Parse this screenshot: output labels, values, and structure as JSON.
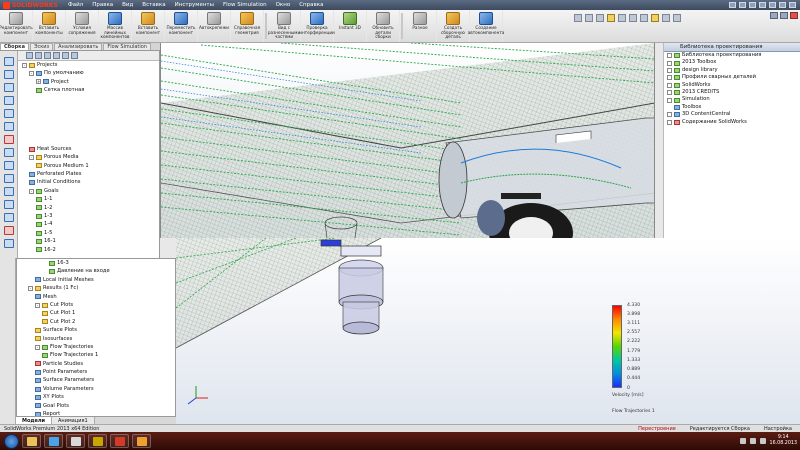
{
  "app": {
    "logo_text": "SOLIDWORKS",
    "menu": [
      "Файл",
      "Правка",
      "Вид",
      "Вставка",
      "Инструменты",
      "Flow Simulation",
      "Окно",
      "Справка"
    ]
  },
  "commands": [
    {
      "label": "Редактировать компонент",
      "icon": "edit-component-icon",
      "tone": "gr"
    },
    {
      "label": "Вставить компоненты",
      "icon": "insert-components-icon",
      "tone": "y"
    },
    {
      "label": "Условия сопряжения",
      "icon": "mate-icon",
      "tone": "gr"
    },
    {
      "label": "Массив линейных компонентов",
      "icon": "linear-pattern-icon",
      "tone": "b"
    },
    {
      "label": "Вставить компонент",
      "icon": "insert-component-icon",
      "tone": "y"
    },
    {
      "label": "Переместить компонент",
      "icon": "move-component-icon",
      "tone": "b"
    },
    {
      "label": "Автокрепежи",
      "icon": "smart-fasteners-icon",
      "tone": "gr"
    },
    {
      "label": "Справочная геометрия",
      "icon": "reference-geometry-icon",
      "tone": "y"
    },
    {
      "label": "Вид с разнесенными частями",
      "icon": "exploded-view-icon",
      "tone": "gr"
    },
    {
      "label": "Проверка интерференции",
      "icon": "interference-icon",
      "tone": "b"
    },
    {
      "label": "Instant 3D",
      "icon": "instant3d-icon",
      "tone": "g"
    },
    {
      "label": "Обновить детали сборки",
      "icon": "update-icon",
      "tone": "gr"
    },
    {
      "label": "Разное",
      "icon": "misc-icon",
      "tone": "gr"
    },
    {
      "label": "Создать сборочную деталь",
      "icon": "assembly-part-icon",
      "tone": "y"
    },
    {
      "label": "Создание автокомпонента",
      "icon": "auto-component-icon",
      "tone": "b"
    }
  ],
  "tabs": [
    "Сборка",
    "Эскиз",
    "Анализировать",
    "Flow Simulation"
  ],
  "tree_top": [
    {
      "label": "Projects",
      "indent": 0,
      "icon": "y",
      "pm": "-"
    },
    {
      "label": "По умолчанию",
      "indent": 1,
      "icon": "b",
      "pm": "-"
    },
    {
      "label": "Project",
      "indent": 2,
      "icon": "b",
      "pm": "+"
    },
    {
      "label": "Сетка плотная",
      "indent": 2,
      "icon": "g",
      "pm": ""
    },
    {
      "label": "",
      "indent": 0,
      "icon": "",
      "pm": ""
    },
    {
      "label": "",
      "indent": 0,
      "icon": "",
      "pm": ""
    },
    {
      "label": "",
      "indent": 0,
      "icon": "",
      "pm": ""
    },
    {
      "label": "",
      "indent": 0,
      "icon": "",
      "pm": ""
    },
    {
      "label": "",
      "indent": 0,
      "icon": "",
      "pm": ""
    },
    {
      "label": "",
      "indent": 0,
      "icon": "",
      "pm": ""
    },
    {
      "label": "Heat Sources",
      "indent": 1,
      "icon": "r",
      "pm": ""
    },
    {
      "label": "Porous Media",
      "indent": 1,
      "icon": "y",
      "pm": "-"
    },
    {
      "label": "Porous Medium 1",
      "indent": 2,
      "icon": "y",
      "pm": ""
    },
    {
      "label": "Perforated Plates",
      "indent": 1,
      "icon": "b",
      "pm": ""
    },
    {
      "label": "Initial Conditions",
      "indent": 1,
      "icon": "b",
      "pm": ""
    },
    {
      "label": "Goals",
      "indent": 1,
      "icon": "g",
      "pm": "-"
    },
    {
      "label": "1-1",
      "indent": 2,
      "icon": "g",
      "pm": ""
    },
    {
      "label": "1-2",
      "indent": 2,
      "icon": "g",
      "pm": ""
    },
    {
      "label": "1-3",
      "indent": 2,
      "icon": "g",
      "pm": ""
    },
    {
      "label": "1-4",
      "indent": 2,
      "icon": "g",
      "pm": ""
    },
    {
      "label": "1-5",
      "indent": 2,
      "icon": "g",
      "pm": ""
    },
    {
      "label": "16-1",
      "indent": 2,
      "icon": "g",
      "pm": ""
    },
    {
      "label": "16-2",
      "indent": 2,
      "icon": "g",
      "pm": ""
    }
  ],
  "tree_bottom": [
    {
      "label": "16-3",
      "indent": 4,
      "icon": "g",
      "pm": ""
    },
    {
      "label": "Давление на входе",
      "indent": 4,
      "icon": "g",
      "pm": ""
    },
    {
      "label": "Local Initial Meshes",
      "indent": 2,
      "icon": "b",
      "pm": ""
    },
    {
      "label": "Results (1 Fc)",
      "indent": 1,
      "icon": "y",
      "pm": "-"
    },
    {
      "label": "Mesh",
      "indent": 2,
      "icon": "b",
      "pm": ""
    },
    {
      "label": "Cut Plots",
      "indent": 2,
      "icon": "y",
      "pm": "-"
    },
    {
      "label": "Cut Plot 1",
      "indent": 3,
      "icon": "y",
      "pm": ""
    },
    {
      "label": "Cut Plot 2",
      "indent": 3,
      "icon": "y",
      "pm": ""
    },
    {
      "label": "Surface Plots",
      "indent": 2,
      "icon": "y",
      "pm": ""
    },
    {
      "label": "Isosurfaces",
      "indent": 2,
      "icon": "y",
      "pm": ""
    },
    {
      "label": "Flow Trajectories",
      "indent": 2,
      "icon": "g",
      "pm": "-"
    },
    {
      "label": "Flow Trajectories 1",
      "indent": 3,
      "icon": "g",
      "pm": ""
    },
    {
      "label": "Particle Studies",
      "indent": 2,
      "icon": "r",
      "pm": ""
    },
    {
      "label": "Point Parameters",
      "indent": 2,
      "icon": "b",
      "pm": ""
    },
    {
      "label": "Surface Parameters",
      "indent": 2,
      "icon": "b",
      "pm": ""
    },
    {
      "label": "Volume Parameters",
      "indent": 2,
      "icon": "b",
      "pm": ""
    },
    {
      "label": "XY Plots",
      "indent": 2,
      "icon": "b",
      "pm": ""
    },
    {
      "label": "Goal Plots",
      "indent": 2,
      "icon": "b",
      "pm": ""
    },
    {
      "label": "Report",
      "indent": 2,
      "icon": "b",
      "pm": ""
    },
    {
      "label": "Animations",
      "indent": 2,
      "icon": "b",
      "pm": ""
    },
    {
      "label": "Reference Parameters",
      "indent": 2,
      "icon": "b",
      "pm": ""
    }
  ],
  "tree_bottom_tabs": [
    "Модели",
    "Анимация1"
  ],
  "taskpane": {
    "title": "Библиотека проектирования",
    "items": [
      {
        "label": "Библиотека проектирования",
        "icon": "g",
        "pm": "+"
      },
      {
        "label": "2013 Toolbox",
        "icon": "g",
        "pm": "+"
      },
      {
        "label": "design library",
        "icon": "g",
        "pm": "+"
      },
      {
        "label": "Профили сварных деталей",
        "icon": "g",
        "pm": "+"
      },
      {
        "label": "SolidWorks",
        "icon": "g",
        "pm": "+"
      },
      {
        "label": "2013 CREDITS",
        "icon": "g",
        "pm": "+"
      },
      {
        "label": "Simulation",
        "icon": "g",
        "pm": "+"
      },
      {
        "label": "Toolbox",
        "icon": "b",
        "pm": ""
      },
      {
        "label": "3D ContentCentral",
        "icon": "b",
        "pm": "+"
      },
      {
        "label": "Содержание SolidWorks",
        "icon": "r",
        "pm": "+"
      }
    ]
  },
  "legend": {
    "values": [
      "4.330",
      "3.898",
      "3.111",
      "2.557",
      "2.222",
      "1.779",
      "1.333",
      "0.889",
      "0.444",
      "0"
    ],
    "title": "Velocity [m/s]",
    "footer": "Flow Trajectories 1"
  },
  "status": {
    "left": "SolidWorks Premium 2013 x64 Edition",
    "warning": "Перестроение",
    "mode": "Редактируется Сборка",
    "units": "Настройка"
  },
  "clock": {
    "time": "9:14",
    "date": "16.08.2013"
  },
  "taskbar_apps": [
    {
      "name": "explorer-app",
      "color": "#e9c35a"
    },
    {
      "name": "media-player-app",
      "color": "#4aa3e8"
    },
    {
      "name": "solidworks-app",
      "color": "#d9d9d9"
    },
    {
      "name": "acrobat-app",
      "color": "#c8a600"
    },
    {
      "name": "solidworks-red-app",
      "color": "#d43a2a"
    },
    {
      "name": "folder-app",
      "color": "#f0a030"
    }
  ]
}
